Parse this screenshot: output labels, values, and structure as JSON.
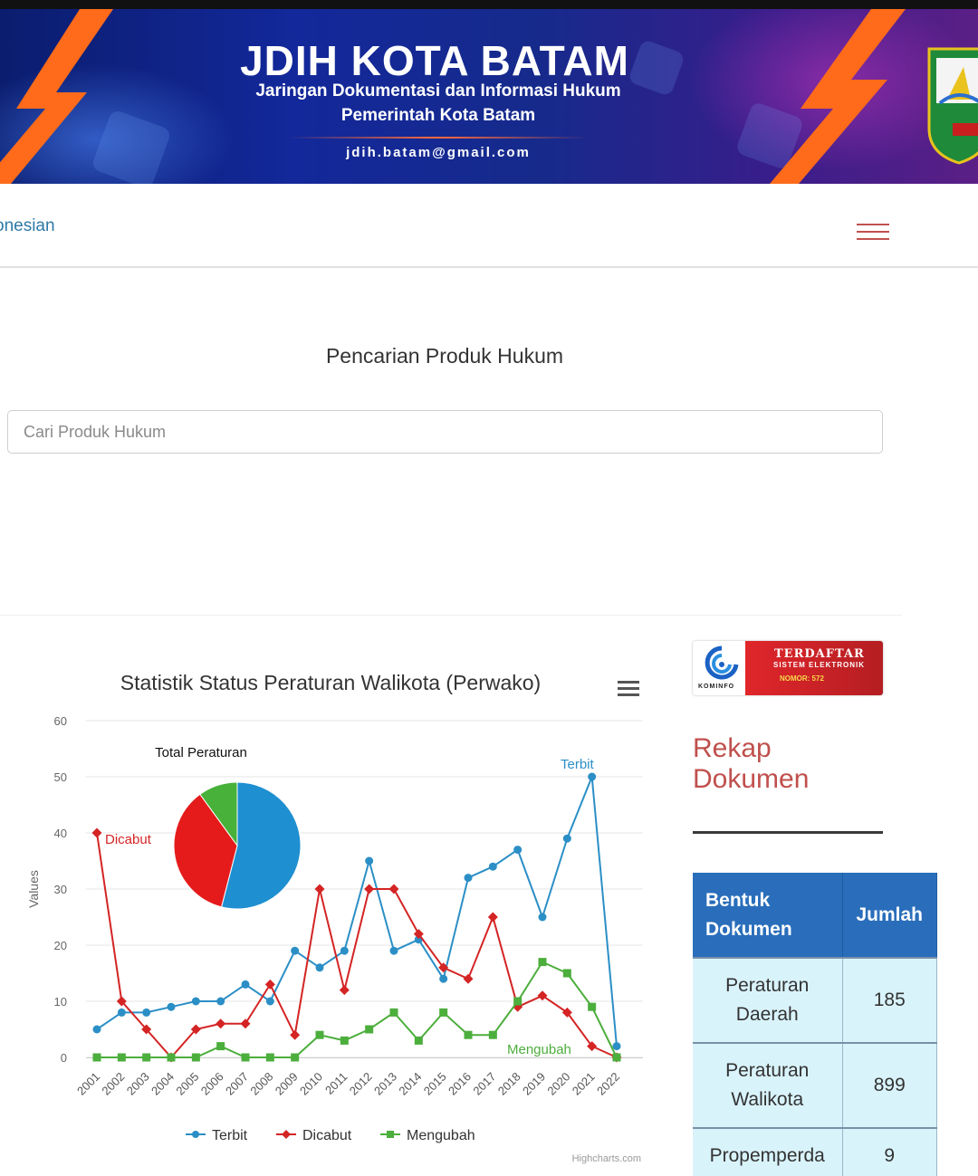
{
  "banner": {
    "title": "JDIH KOTA BATAM",
    "subtitle_line1": "Jaringan Dokumentasi dan Informasi Hukum",
    "subtitle_line2": "Pemerintah Kota Batam",
    "email": "jdih.batam@gmail.com",
    "colors": {
      "background": "#13289a",
      "accent": "#ff6b1a"
    }
  },
  "navbar": {
    "language_link": "onesian",
    "menu_icon": "hamburger-icon",
    "menu_color": "#c0504d"
  },
  "search": {
    "title": "Pencarian Produk Hukum",
    "placeholder": "Cari Produk Hukum",
    "value": ""
  },
  "chart": {
    "menu_icon": "hamburger-icon",
    "legend": [
      "Terbit",
      "Dicabut",
      "Mengubah"
    ],
    "credit": "Highcharts.com",
    "pie_title": "Total Peraturan"
  },
  "chart_data": [
    {
      "type": "line",
      "title": "Statistik Status Peraturan Walikota (Perwako)",
      "xlabel": "",
      "ylabel": "Values",
      "ylim": [
        0,
        60
      ],
      "yticks": [
        0,
        10,
        20,
        30,
        40,
        50,
        60
      ],
      "grid": true,
      "legend_position": "bottom",
      "categories": [
        "2001",
        "2002",
        "2003",
        "2004",
        "2005",
        "2006",
        "2007",
        "2008",
        "2009",
        "2010",
        "2011",
        "2012",
        "2013",
        "2014",
        "2015",
        "2016",
        "2017",
        "2018",
        "2019",
        "2020",
        "2021",
        "2022"
      ],
      "series": [
        {
          "name": "Terbit",
          "color": "#2b8fc6",
          "marker": "circle",
          "label": "Terbit",
          "values": [
            5,
            8,
            8,
            9,
            10,
            10,
            13,
            10,
            19,
            16,
            19,
            35,
            19,
            21,
            14,
            32,
            34,
            37,
            25,
            39,
            50,
            2
          ]
        },
        {
          "name": "Dicabut",
          "color": "#d42424",
          "marker": "diamond",
          "label": "Dicabut",
          "values": [
            40,
            10,
            5,
            0,
            5,
            6,
            6,
            13,
            4,
            30,
            12,
            30,
            30,
            22,
            16,
            14,
            25,
            9,
            11,
            8,
            2,
            0
          ]
        },
        {
          "name": "Mengubah",
          "color": "#4cae3c",
          "marker": "square",
          "label": "Mengubah",
          "values": [
            0,
            0,
            0,
            0,
            0,
            2,
            0,
            0,
            0,
            4,
            3,
            5,
            8,
            3,
            8,
            4,
            4,
            10,
            17,
            15,
            9,
            0
          ]
        }
      ]
    },
    {
      "type": "pie",
      "title": "Total Peraturan",
      "slices": [
        {
          "name": "Terbit",
          "value": 54,
          "color": "#1e8fd0"
        },
        {
          "name": "Dicabut",
          "value": 36,
          "color": "#e51b1b"
        },
        {
          "name": "Mengubah",
          "value": 10,
          "color": "#47b13a"
        }
      ]
    }
  ],
  "badge": {
    "line1": "TERDAFTAR",
    "line2": "SISTEM ELEKTRONIK",
    "line3": "NOMOR: 572",
    "logo_text": "KOMINFO"
  },
  "rekap": {
    "title": "Rekap Dokumen",
    "headers": {
      "bentuk": "Bentuk Dokumen",
      "jumlah": "Jumlah"
    },
    "rows": [
      {
        "bentuk": "Peraturan Daerah",
        "jumlah": "185"
      },
      {
        "bentuk": "Peraturan Walikota",
        "jumlah": "899"
      },
      {
        "bentuk": "Propemperda",
        "jumlah": "9"
      }
    ],
    "colors": {
      "header": "#2a6ebb",
      "row": "#d9f3fb",
      "title": "#c0504d"
    }
  }
}
